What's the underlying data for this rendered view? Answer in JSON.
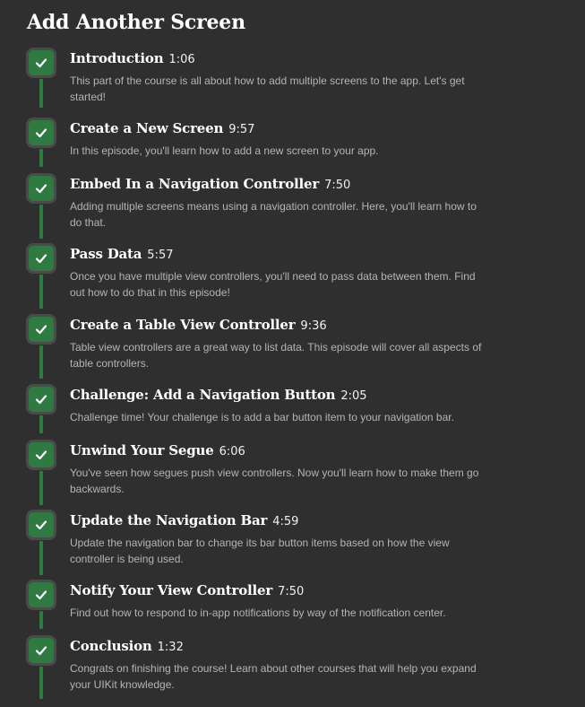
{
  "section": {
    "title": "Add Another Screen"
  },
  "episodes": [
    {
      "title": "Introduction",
      "duration": "1:06",
      "description": "This part of the course is all about how to add multiple screens to the app. Let's get started!",
      "completed": true
    },
    {
      "title": "Create a New Screen",
      "duration": "9:57",
      "description": "In this episode, you'll learn how to add a new screen to your app.",
      "completed": true
    },
    {
      "title": "Embed In a Navigation Controller",
      "duration": "7:50",
      "description": "Adding multiple screens means using a navigation controller. Here, you'll learn how to do that.",
      "completed": true
    },
    {
      "title": "Pass Data",
      "duration": "5:57",
      "description": "Once you have multiple view controllers, you'll need to pass data between them. Find out how to do that in this episode!",
      "completed": true
    },
    {
      "title": "Create a Table View Controller",
      "duration": "9:36",
      "description": "Table view controllers are a great way to list data. This episode will cover all aspects of table controllers.",
      "completed": true
    },
    {
      "title": "Challenge: Add a Navigation Button",
      "duration": "2:05",
      "description": "Challenge time! Your challenge is to add a bar button item to your navigation bar.",
      "completed": true
    },
    {
      "title": "Unwind Your Segue",
      "duration": "6:06",
      "description": "You've seen how segues push view controllers. Now you'll learn how to make them go backwards.",
      "completed": true
    },
    {
      "title": "Update the Navigation Bar",
      "duration": "4:59",
      "description": "Update the navigation bar to change its bar button items based on how the view controller is being used.",
      "completed": true
    },
    {
      "title": "Notify Your View Controller",
      "duration": "7:50",
      "description": "Find out how to respond to in-app notifications by way of the notification center.",
      "completed": true
    },
    {
      "title": "Conclusion",
      "duration": "1:32",
      "description": "Congrats on finishing the course! Learn about other courses that will help you expand your UIKit knowledge.",
      "completed": true
    }
  ],
  "colors": {
    "background": "#2f2f2f",
    "check_fill": "#2e7a41",
    "check_border": "#4a4a4a",
    "connector": "#2e7a41"
  },
  "icons": {
    "episode_status": "checkmark-icon"
  }
}
